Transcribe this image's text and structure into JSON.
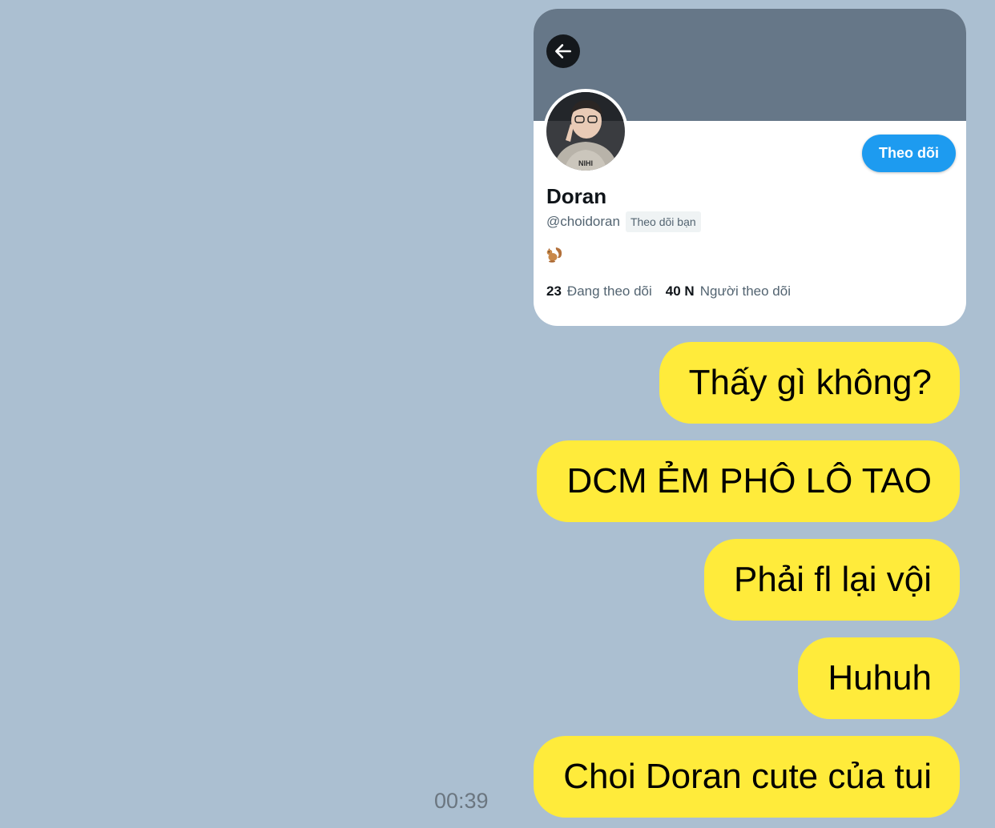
{
  "profile_card": {
    "name": "Doran",
    "handle": "@choidoran",
    "follows_you_badge": "Theo dõi bạn",
    "follow_button": "Theo dõi",
    "bio_icon": "squirrel-emoji",
    "stats": {
      "following_count": "23",
      "following_label": "Đang theo dõi",
      "followers_count": "40 N",
      "followers_label": "Người theo dõi"
    },
    "colors": {
      "banner": "#667788",
      "follow_button": "#1d9bf0"
    }
  },
  "messages": [
    {
      "text": "Thấy gì không?"
    },
    {
      "text": "DCM ẺM PHÔ LÔ TAO"
    },
    {
      "text": "Phải fl lại vội"
    },
    {
      "text": "Huhuh"
    },
    {
      "text": "Choi Doran cute của tui"
    }
  ],
  "timestamp": "00:39",
  "colors": {
    "chat_background": "#abbfd1",
    "bubble": "#ffeb3b"
  }
}
